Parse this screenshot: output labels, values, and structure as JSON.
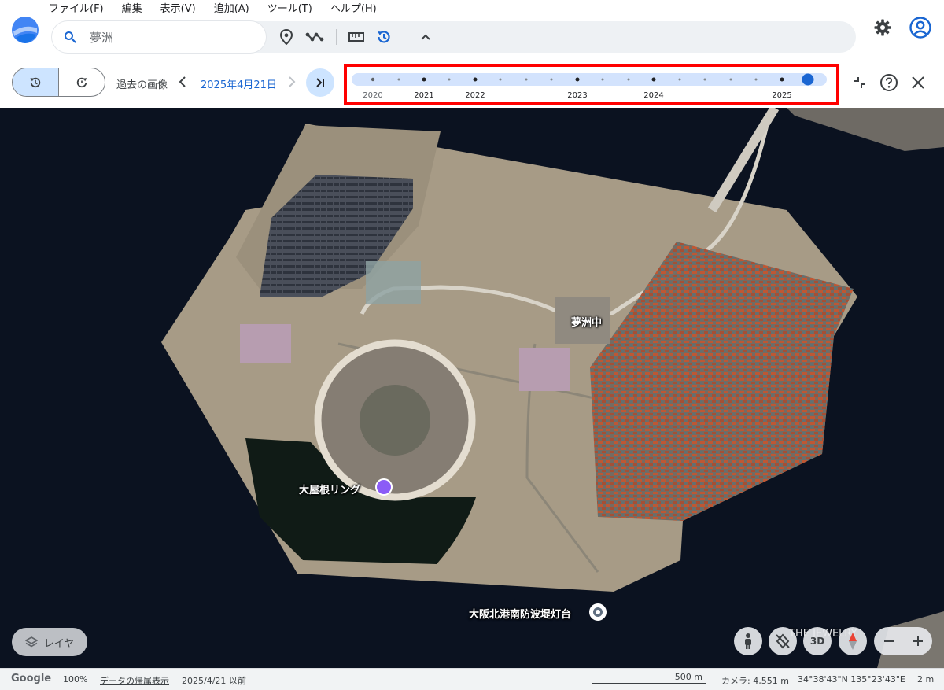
{
  "menu": [
    "ファイル(F)",
    "編集",
    "表示(V)",
    "追加(A)",
    "ツール(T)",
    "ヘルプ(H)"
  ],
  "search": {
    "value": "夢洲",
    "icon": "search-icon"
  },
  "toolbar": {
    "icons": [
      "place-pin-icon",
      "path-icon",
      "ruler-icon",
      "history-icon",
      "chevron-up-icon"
    ],
    "settings_icon": "gear-icon",
    "account_icon": "account-circle-icon"
  },
  "history": {
    "label": "過去の画像",
    "current_date": "2025年4月21日",
    "timeline_years": [
      "2020",
      "2021",
      "2022",
      "2023",
      "2024",
      "2025"
    ],
    "accent_color": "#1a66d2"
  },
  "map": {
    "labels": {
      "junior_high": "夢洲中",
      "ring": "大屋根リング",
      "lighthouse": "大阪北港南防波堤灯台"
    },
    "watermark": "THE JEWELRY",
    "layer_button": "レイヤ",
    "threed_button": "3D"
  },
  "status": {
    "logo": "Google",
    "zoom": "100%",
    "attribution": "データの帰属表示",
    "imagery_date": "2025/4/21 以前",
    "scale": "500 m",
    "camera": "カメラ: 4,551 m",
    "coords": "34°38'43\"N 135°23'43\"E",
    "elevation": "2 m"
  }
}
